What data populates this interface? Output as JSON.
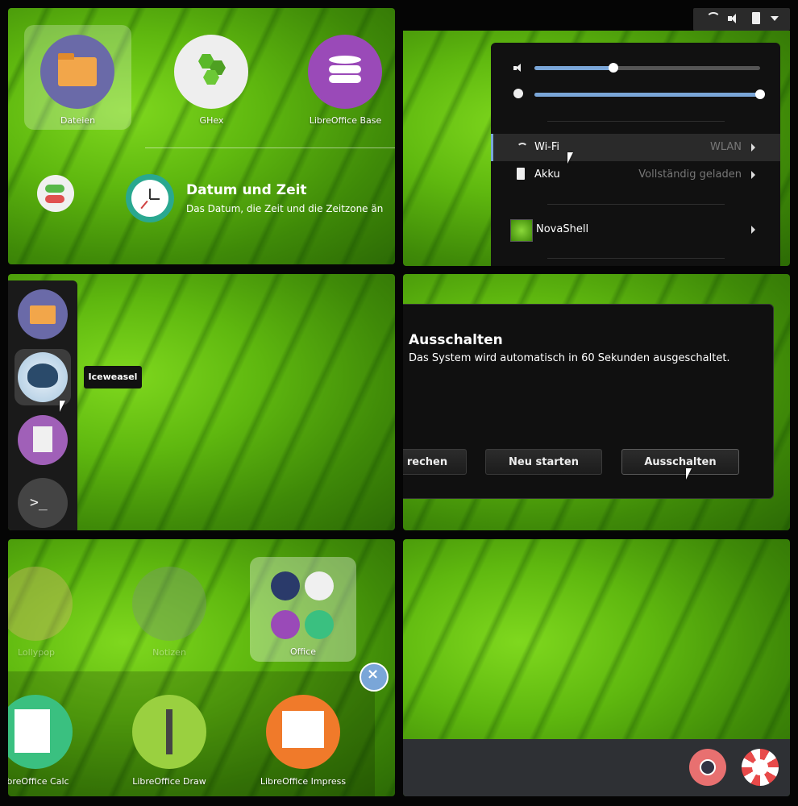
{
  "panel1": {
    "apps": [
      {
        "label": "Dateien",
        "icon": "folder-icon"
      },
      {
        "label": "GHex",
        "icon": "hex-icon"
      },
      {
        "label": "LibreOffice Base",
        "icon": "database-icon"
      }
    ],
    "settings_item": {
      "title": "Datum und Zeit",
      "desc": "Das Datum, die Zeit und die Zeitzone än"
    }
  },
  "panel2": {
    "topbar_icons": [
      "wifi-icon",
      "volume-icon",
      "battery-icon",
      "dropdown-arrow-icon"
    ],
    "volume_level": 0.35,
    "brightness_level": 1.0,
    "menu": [
      {
        "label": "Wi-Fi",
        "value": "WLAN",
        "icon": "wifi-icon"
      },
      {
        "label": "Akku",
        "value": "Vollständig geladen",
        "icon": "battery-icon"
      }
    ],
    "user": {
      "label": "NovaShell"
    }
  },
  "panel3": {
    "dock_items": [
      "folder-icon",
      "iceweasel-icon",
      "text-editor-icon",
      "terminal-icon"
    ],
    "tooltip": "Iceweasel"
  },
  "panel4": {
    "dialog": {
      "title": "Ausschalten",
      "message": "Das System wird automatisch in 60 Sekunden ausgeschaltet.",
      "buttons": [
        "rechen",
        "Neu starten",
        "Ausschalten"
      ]
    }
  },
  "panel5": {
    "faded_apps": [
      {
        "label": "Lollypop",
        "icon": "lollypop-icon"
      },
      {
        "label": "Notizen",
        "icon": "notes-icon"
      }
    ],
    "folder": {
      "label": "Office"
    },
    "apps": [
      {
        "label": "breOffice Calc",
        "icon": "spreadsheet-icon"
      },
      {
        "label": "LibreOffice Draw",
        "icon": "draw-icon"
      },
      {
        "label": "LibreOffice Impress",
        "icon": "impress-icon"
      }
    ]
  },
  "panel6": {
    "tray_icons": [
      "camera-icon",
      "lollypop-icon"
    ]
  }
}
